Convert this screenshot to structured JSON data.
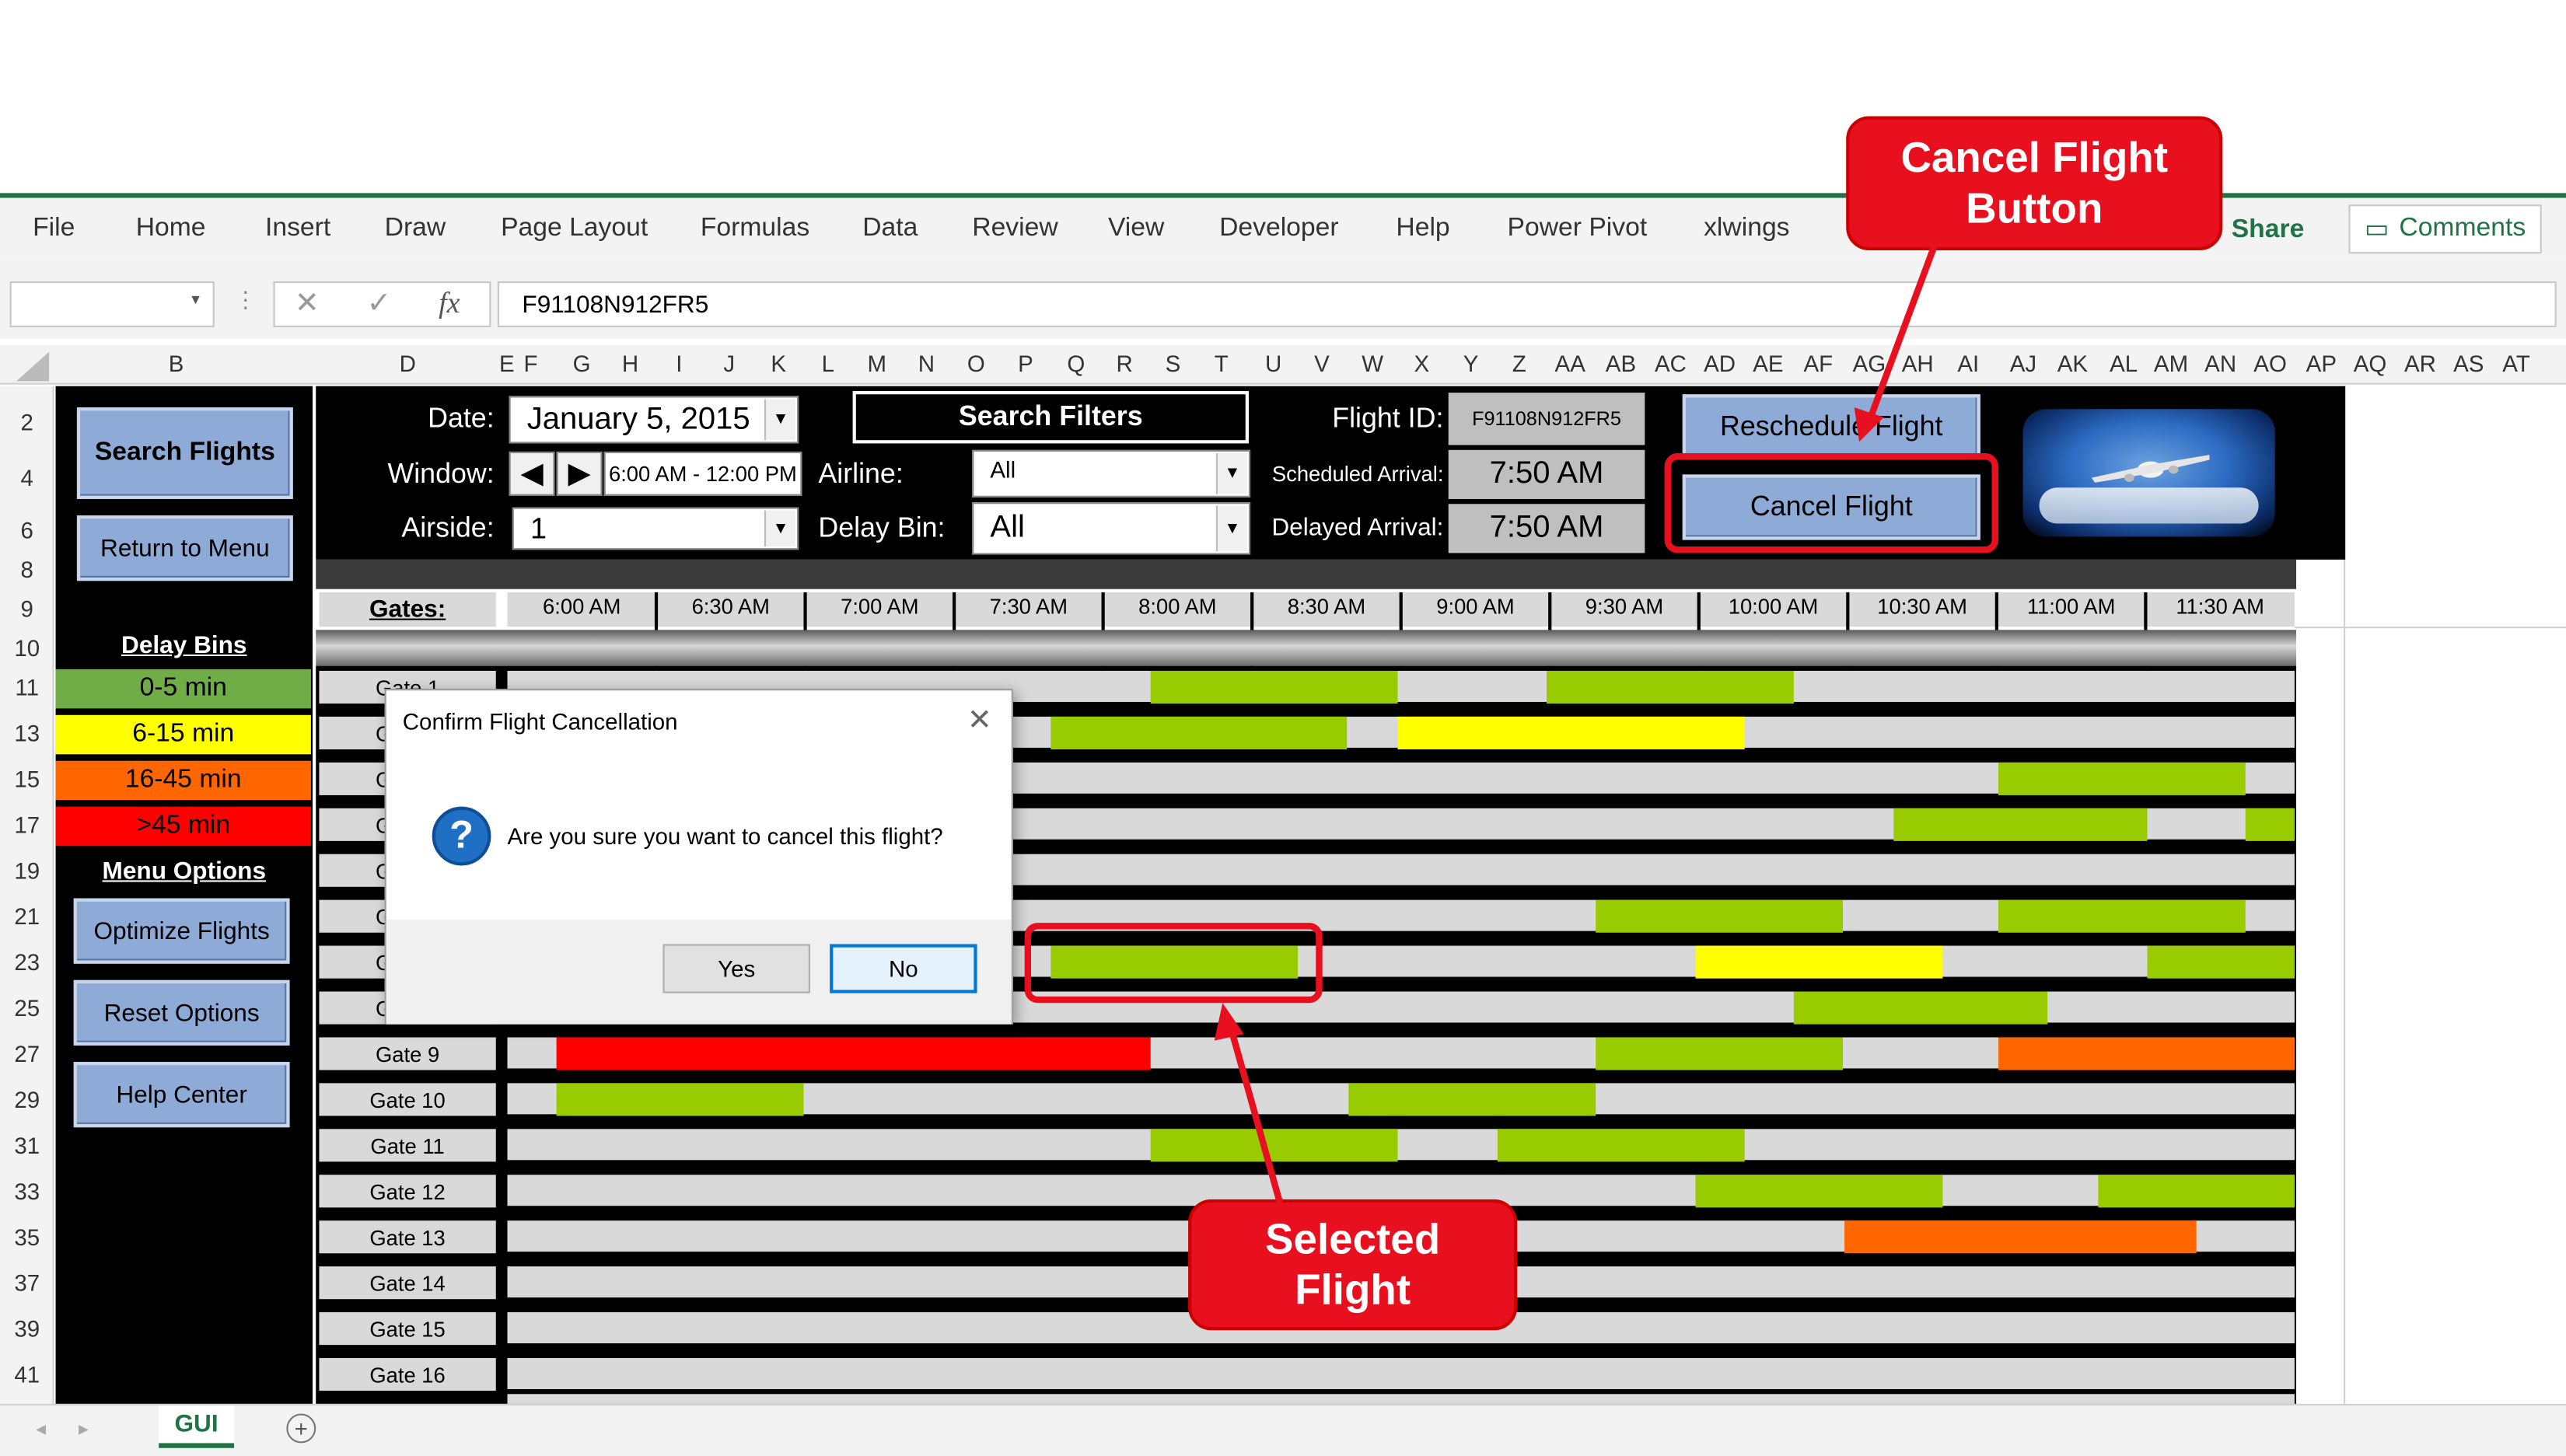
{
  "ribbon": {
    "tabs": [
      "File",
      "Home",
      "Insert",
      "Draw",
      "Page Layout",
      "Formulas",
      "Data",
      "Review",
      "View",
      "Developer",
      "Help",
      "Power Pivot",
      "xlwings"
    ],
    "share": "Share",
    "comments": "Comments"
  },
  "formula_bar": {
    "value": "F91108N912FR5",
    "fx": "fx"
  },
  "columns": [
    "B",
    "D",
    "E",
    "F",
    "G",
    "H",
    "I",
    "J",
    "K",
    "L",
    "M",
    "N",
    "O",
    "P",
    "Q",
    "R",
    "S",
    "T",
    "U",
    "V",
    "W",
    "X",
    "Y",
    "Z",
    "AA",
    "AB",
    "AC",
    "AD",
    "AE",
    "AF",
    "AG",
    "AH",
    "AI",
    "AJ",
    "AK",
    "AL",
    "AM",
    "AN",
    "AO",
    "AP",
    "AQ",
    "AR",
    "AS",
    "AT"
  ],
  "rows": [
    "2",
    "4",
    "6",
    "8",
    "9",
    "10",
    "11",
    "13",
    "15",
    "17",
    "19",
    "21",
    "23",
    "25",
    "27",
    "29",
    "31",
    "33",
    "35",
    "37",
    "39",
    "41"
  ],
  "sidebar": {
    "search_flights": "Search Flights",
    "return_to_menu": "Return to Menu",
    "delay_bins_title": "Delay Bins",
    "bins": [
      {
        "label": "0-5 min",
        "color": "#70ad47"
      },
      {
        "label": "6-15 min",
        "color": "#ffff00"
      },
      {
        "label": "16-45 min",
        "color": "#ff6600"
      },
      {
        "label": ">45 min",
        "color": "#ff0000"
      }
    ],
    "menu_options_title": "Menu Options",
    "optimize_flights": "Optimize Flights",
    "reset_options": "Reset Options",
    "help_center": "Help Center"
  },
  "controls": {
    "date_label": "Date:",
    "date_value": "January 5, 2015",
    "window_label": "Window:",
    "window_value": "6:00 AM - 12:00 PM",
    "airside_label": "Airside:",
    "airside_value": "1",
    "search_filters": "Search Filters",
    "airline_label": "Airline:",
    "airline_value": "All",
    "delay_bin_label": "Delay Bin:",
    "delay_bin_value": "All",
    "flight_id_label": "Flight ID:",
    "flight_id_value": "F91108N912FR5",
    "scheduled_arrival_label": "Scheduled Arrival:",
    "scheduled_arrival_value": "7:50 AM",
    "delayed_arrival_label": "Delayed Arrival:",
    "delayed_arrival_value": "7:50 AM",
    "reschedule_flight": "Reschedule Flight",
    "cancel_flight": "Cancel Flight"
  },
  "gantt": {
    "gates_header": "Gates:",
    "times": [
      "6:00 AM",
      "6:30 AM",
      "7:00 AM",
      "7:30 AM",
      "8:00 AM",
      "8:30 AM",
      "9:00 AM",
      "9:30 AM",
      "10:00 AM",
      "10:30 AM",
      "11:00 AM",
      "11:30 AM"
    ],
    "gates": [
      "Gate 1",
      "Gate 2",
      "Gate 3",
      "Gate 4",
      "Gate 5",
      "Gate 6",
      "Gate 7",
      "Gate 8",
      "Gate 9",
      "Gate 10",
      "Gate 11",
      "Gate 12",
      "Gate 13",
      "Gate 14",
      "Gate 15",
      "Gate 16"
    ]
  },
  "dialog": {
    "title": "Confirm Flight Cancellation",
    "message": "Are you sure you want to cancel this flight?",
    "yes": "Yes",
    "no": "No"
  },
  "callouts": {
    "cancel_button": "Cancel Flight Button",
    "selected_flight": "Selected Flight"
  },
  "sheet_tab": "GUI",
  "colors": {
    "green": "#99cc00",
    "yellow": "#ffff00",
    "orange": "#ff6600",
    "red": "#ff0000",
    "callout": "#e8101f",
    "button_blue": "#8eaad6"
  }
}
